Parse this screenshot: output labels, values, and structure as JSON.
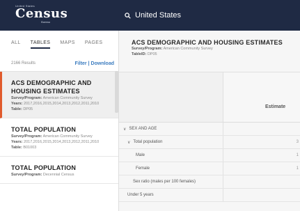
{
  "header": {
    "logo_top": "United States",
    "logo_main": "Census",
    "logo_bottom": "Bureau",
    "search_value": "United States"
  },
  "sidebar": {
    "tabs": [
      {
        "label": "ALL"
      },
      {
        "label": "TABLES"
      },
      {
        "label": "MAPS"
      },
      {
        "label": "PAGES"
      }
    ],
    "results_count": "2166 Results",
    "filter_label": "Filter",
    "download_label": "Download",
    "results": [
      {
        "title": "ACS DEMOGRAPHIC AND HOUSING ESTIMATES",
        "survey_label": "Survey/Program:",
        "survey": "American Community Survey",
        "years_label": "Years:",
        "years": "2017,2016,2015,2014,2013,2012,2011,2010",
        "table_label": "Table:",
        "table": "DP05"
      },
      {
        "title": "TOTAL POPULATION",
        "survey_label": "Survey/Program:",
        "survey": "American Community Survey",
        "years_label": "Years:",
        "years": "2017,2016,2015,2014,2013,2012,2011,2010",
        "table_label": "Table:",
        "table": "B01003"
      },
      {
        "title": "TOTAL POPULATION",
        "survey_label": "Survey/Program:",
        "survey": "Decennial Census"
      }
    ]
  },
  "main": {
    "table_title": "ACS DEMOGRAPHIC AND HOUSING ESTIMATES",
    "survey_label": "Survey/Program:",
    "survey": "American Community Survey",
    "tableid_label": "TableID:",
    "tableid": "DP05",
    "estimate_header": "Estimate",
    "rows": [
      {
        "label": "SEX AND AGE",
        "value": ""
      },
      {
        "label": "Total population",
        "value": "3"
      },
      {
        "label": "Male",
        "value": "1"
      },
      {
        "label": "Female",
        "value": "1"
      },
      {
        "label": "Sex ratio (males per 100 females)",
        "value": ""
      },
      {
        "label": "Under 5 years",
        "value": ""
      }
    ]
  }
}
